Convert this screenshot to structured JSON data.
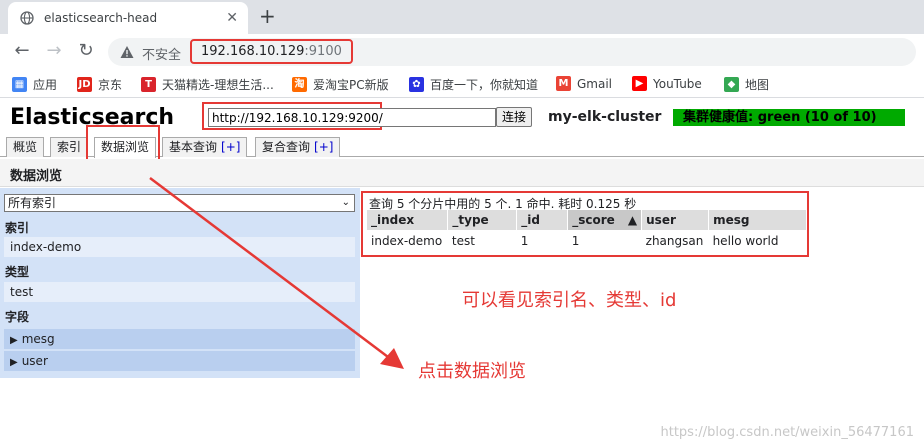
{
  "browser": {
    "tab_title": "elasticsearch-head",
    "insecure_label": "不安全",
    "url_host": "192.168.10.129",
    "url_port": ":9100",
    "bookmarks": [
      {
        "label": "应用",
        "icon": "apps-icon",
        "color": "#4285f4"
      },
      {
        "label": "京东",
        "icon": "jd-icon",
        "color": "#e1251b"
      },
      {
        "label": "天猫精选-理想生活...",
        "icon": "tmall-icon",
        "color": "#d9242c"
      },
      {
        "label": "爱淘宝PC新版",
        "icon": "taobao-icon",
        "color": "#ff6a00"
      },
      {
        "label": "百度一下，你就知道",
        "icon": "baidu-icon",
        "color": "#2932e1"
      },
      {
        "label": "Gmail",
        "icon": "gmail-icon",
        "color": "#ea4335"
      },
      {
        "label": "YouTube",
        "icon": "youtube-icon",
        "color": "#ff0000"
      },
      {
        "label": "地图",
        "icon": "maps-icon",
        "color": "#34a853"
      }
    ]
  },
  "head": {
    "brand": "Elasticsearch",
    "cluster_url": "http://192.168.10.129:9200/",
    "connect_label": "连接",
    "cluster_name": "my-elk-cluster",
    "health": "集群健康值: green (10 of 10)",
    "health_color": "#00aa00",
    "tabs": [
      {
        "label": "概览",
        "plus": ""
      },
      {
        "label": "索引",
        "plus": ""
      },
      {
        "label": "数据浏览",
        "plus": ""
      },
      {
        "label": "基本查询",
        "plus": "[+]"
      },
      {
        "label": "复合查询",
        "plus": "[+]"
      }
    ],
    "section_title": "数据浏览"
  },
  "sidebar": {
    "select_value": "所有索引",
    "index_label": "索引",
    "index_item": "index-demo",
    "type_label": "类型",
    "type_item": "test",
    "field_label": "字段",
    "fields": [
      "mesg",
      "user"
    ]
  },
  "results": {
    "info": "查询 5 个分片中用的 5 个. 1 命中. 耗时 0.125 秒",
    "columns": [
      "_index",
      "_type",
      "_id",
      "_score",
      "user",
      "mesg"
    ],
    "sorted_column_marker": "▲",
    "rows": [
      [
        "index-demo",
        "test",
        "1",
        "1",
        "zhangsan",
        "hello world"
      ]
    ]
  },
  "annotations": {
    "note1": "可以看见索引名、类型、id",
    "note2": "点击数据浏览",
    "color": "#e53935"
  },
  "watermark": "https://blog.csdn.net/weixin_56477161"
}
